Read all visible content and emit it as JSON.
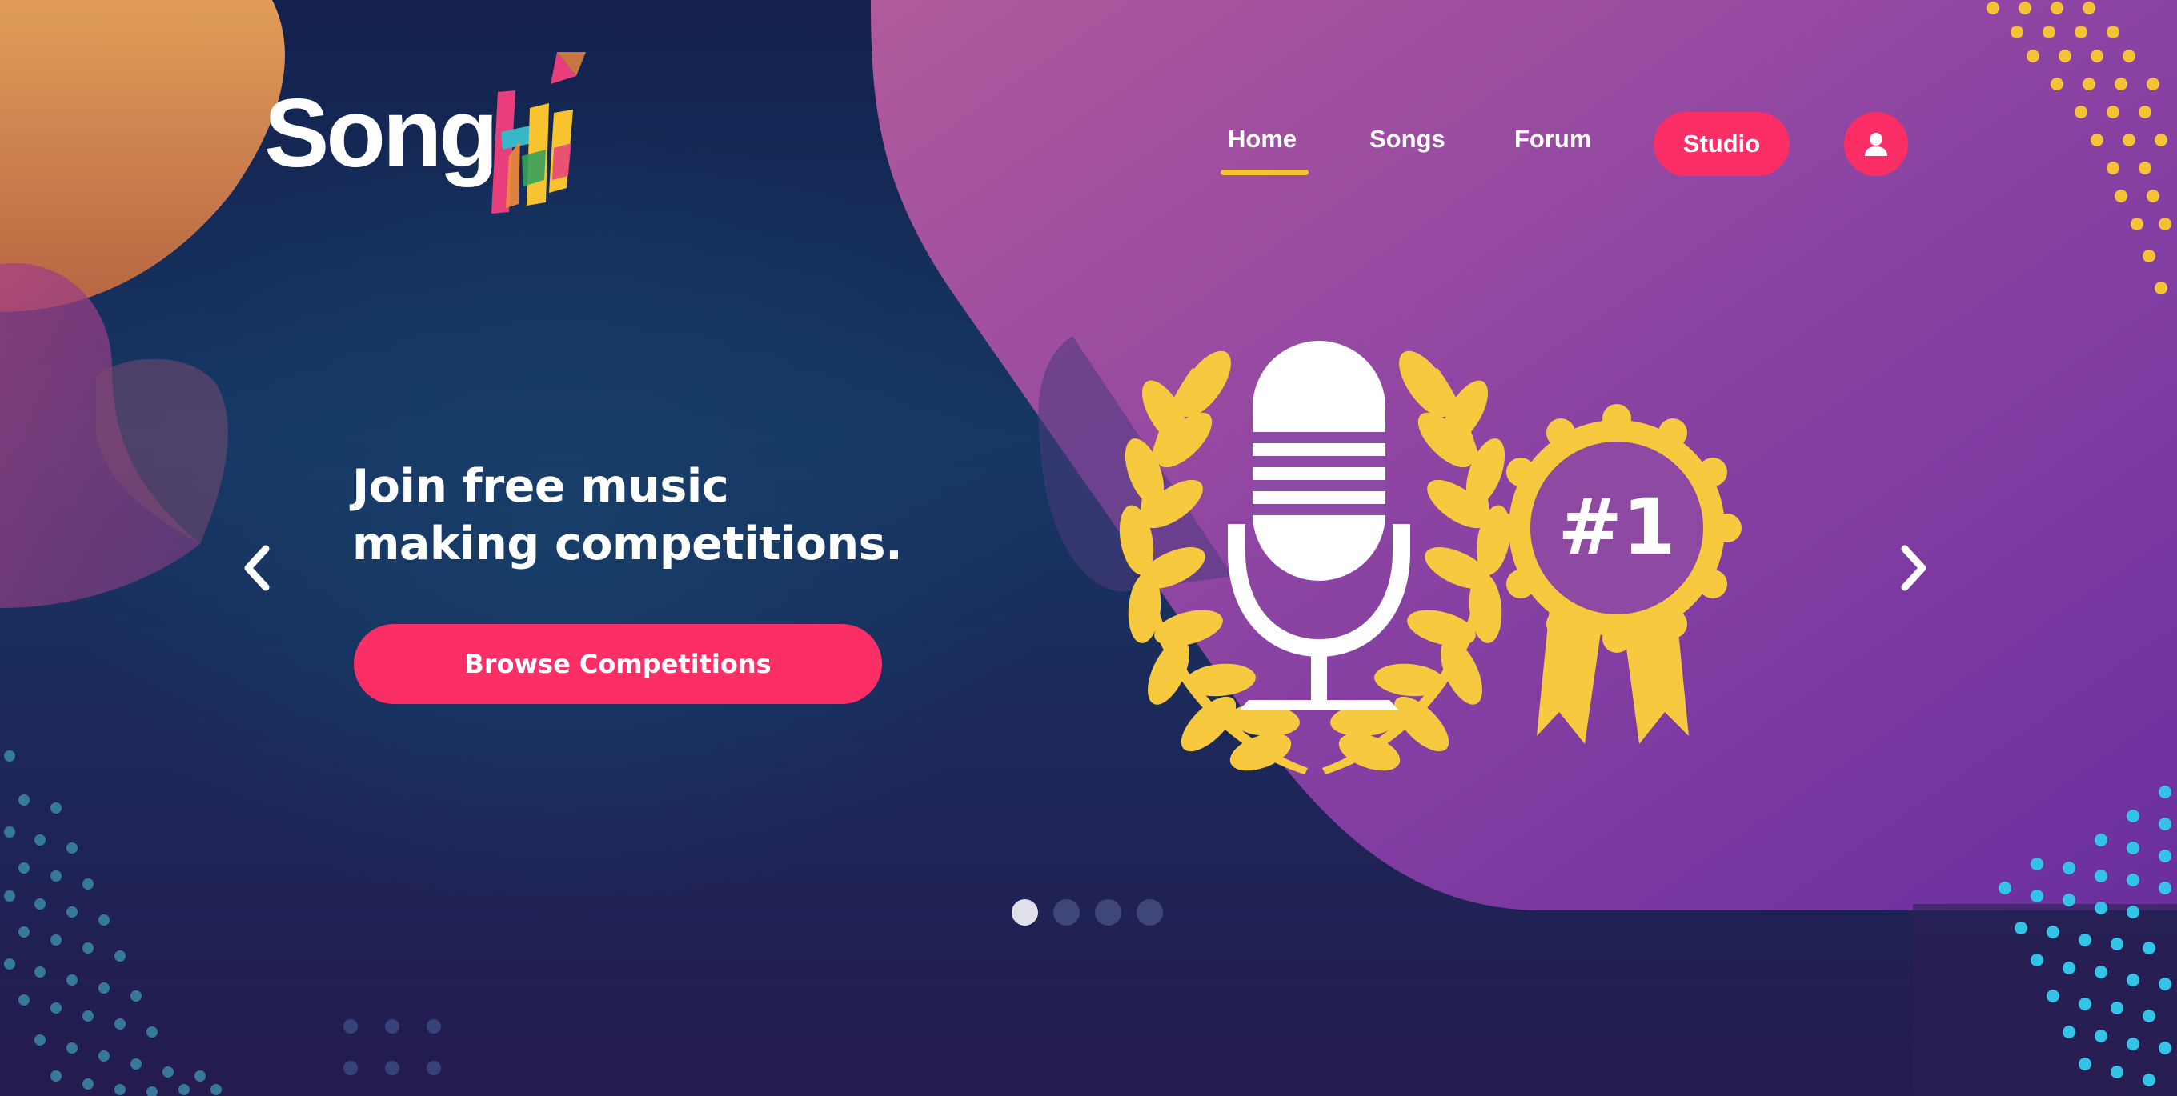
{
  "brand": {
    "name_part1": "Song",
    "name_part2": "Hi"
  },
  "nav": {
    "items": [
      {
        "label": "Home",
        "active": true
      },
      {
        "label": "Songs",
        "active": false
      },
      {
        "label": "Forum",
        "active": false
      }
    ],
    "studio_label": "Studio",
    "user_icon": "user-icon"
  },
  "hero": {
    "headline_line1": "Join free music",
    "headline_line2": "making competitions.",
    "cta_label": "Browse Competitions",
    "badge_text": "#1"
  },
  "carousel": {
    "slide_count": 4,
    "active_index": 0,
    "prev_icon": "chevron-left-icon",
    "next_icon": "chevron-right-icon"
  },
  "colors": {
    "accent_pink": "#fb2f66",
    "gold": "#f6c235",
    "purple_panel": "#8a3f9e",
    "navy_bg": "#163764"
  }
}
